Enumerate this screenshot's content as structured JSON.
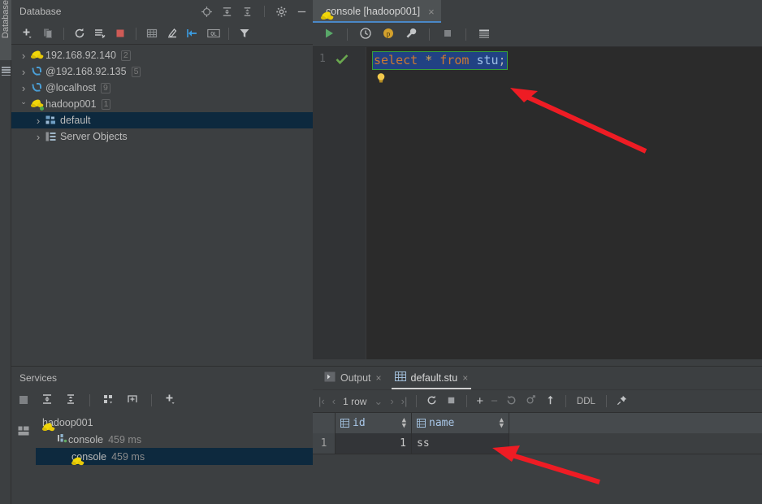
{
  "window": {
    "vertical_tool_tab": "Database"
  },
  "database_panel": {
    "title": "Database",
    "header_icons": [
      "locate-icon",
      "expand-all-icon",
      "collapse-all-icon",
      "gear-icon",
      "minimize-icon"
    ],
    "toolbar_icons": [
      "add-icon",
      "copy-icon",
      "refresh-icon",
      "sync-settings-icon",
      "stop-icon",
      "table-icon",
      "edit-icon",
      "jump-to-icon",
      "ql-console-icon",
      "filter-icon"
    ],
    "tree": [
      {
        "label": "192.168.92.140",
        "badge": "2",
        "icon": "mysql-dolphin-icon",
        "expanded": false,
        "indent": 0,
        "selected": false
      },
      {
        "label": "@192.168.92.135",
        "badge": "5",
        "icon": "sqlite-bird-icon",
        "expanded": false,
        "indent": 0,
        "selected": false
      },
      {
        "label": "@localhost",
        "badge": "9",
        "icon": "sqlite-bird-icon",
        "expanded": false,
        "indent": 0,
        "selected": false
      },
      {
        "label": "hadoop001",
        "badge": "1",
        "icon": "mysql-dolphin-icon",
        "expanded": true,
        "indent": 0,
        "selected": false
      },
      {
        "label": "default",
        "badge": "",
        "icon": "schema-icon",
        "expanded": false,
        "indent": 1,
        "selected": true
      },
      {
        "label": "Server Objects",
        "badge": "",
        "icon": "server-objects-icon",
        "expanded": false,
        "indent": 1,
        "selected": false
      }
    ]
  },
  "editor": {
    "tab": {
      "label": "console [hadoop001]",
      "icon": "mysql-dolphin-icon",
      "close": "×"
    },
    "toolbar_icons": [
      "run-icon",
      "history-icon",
      "parameters-icon",
      "wrench-icon",
      "stop-icon",
      "grid-icon"
    ],
    "gutter": {
      "line_number": "1",
      "status": "check-icon"
    },
    "sql": {
      "keyword1": "select",
      "star": "*",
      "keyword2": "from",
      "table": "stu",
      "terminator": ";",
      "full_text": "select * from stu;"
    },
    "intention_bulb": "lightbulb-icon"
  },
  "services_panel": {
    "title": "Services",
    "left_icons": [
      "stop-icon",
      "layout-icon"
    ],
    "toolbar_icons": [
      "expand-all-icon",
      "collapse-all-icon",
      "group-icon",
      "add-frame-icon",
      "add-icon"
    ],
    "tree": [
      {
        "label": "hadoop001",
        "time": "",
        "icon": "mysql-dolphin-icon",
        "expanded": true,
        "indent": 0,
        "selected": false
      },
      {
        "label": "console",
        "time": "459 ms",
        "icon": "session-icon",
        "expanded": true,
        "indent": 1,
        "selected": false
      },
      {
        "label": "console",
        "time": "459 ms",
        "icon": "mysql-dolphin-icon",
        "expanded": false,
        "indent": 2,
        "selected": true
      }
    ]
  },
  "results_panel": {
    "tabs": [
      {
        "label": "Output",
        "icon": "output-icon",
        "close": "×",
        "active": false
      },
      {
        "label": "default.stu",
        "icon": "table-icon",
        "close": "×",
        "active": true
      }
    ],
    "toolbar": {
      "first_page": "|‹",
      "prev_page": "‹",
      "row_count": "1 row",
      "row_count_caret": "⌄",
      "next_page": "›",
      "last_page": "›|",
      "reload_icon": "refresh-icon",
      "cancel_icon": "stop-icon",
      "add_row": "+",
      "remove_row": "−",
      "revert_icon": "revert-icon",
      "submit_icon": "submit-icon",
      "upload_icon": "upload-icon",
      "ddl_label": "DDL",
      "pin_icon": "pin-icon"
    },
    "grid": {
      "columns": [
        {
          "name": "id",
          "icon": "column-icon",
          "sort": "sort-icon"
        },
        {
          "name": "name",
          "icon": "column-icon",
          "sort": "sort-icon"
        }
      ],
      "rows": [
        {
          "num": "1",
          "id": "1",
          "name": "ss"
        }
      ]
    }
  },
  "annotations": {
    "arrows": [
      {
        "name": "arrow-to-editor",
        "color": "#ee1c24"
      },
      {
        "name": "arrow-to-grid-header",
        "color": "#ee1c24"
      }
    ]
  },
  "colors": {
    "panel_bg": "#3c3f41",
    "editor_bg": "#2b2b2b",
    "selection_blue": "#214283",
    "tree_selected": "#0d293e",
    "accent_blue": "#4a88c7",
    "arrow_red": "#ee1c24",
    "keyword_orange": "#cc7832",
    "table_blue": "#9fc0e8"
  }
}
